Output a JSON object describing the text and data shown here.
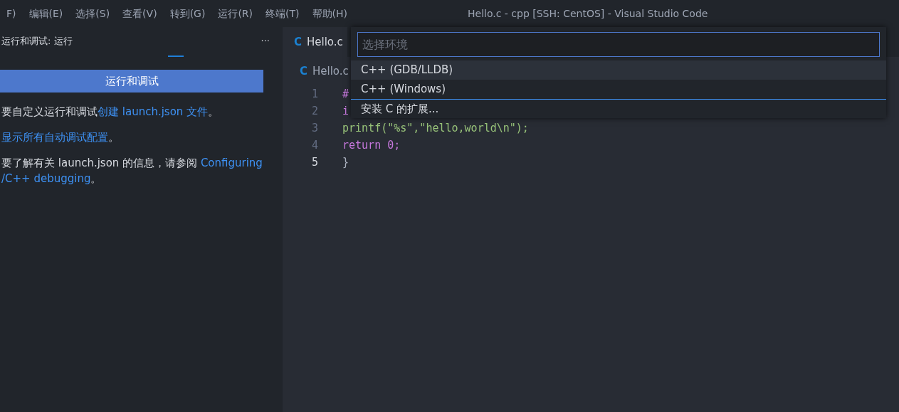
{
  "menu_bar": {
    "items": [
      "F)",
      "编辑(E)",
      "选择(S)",
      "查看(V)",
      "转到(G)",
      "运行(R)",
      "终端(T)",
      "帮助(H)"
    ]
  },
  "window": {
    "title": "Hello.c - cpp [SSH: CentOS] - Visual Studio Code"
  },
  "sidebar": {
    "title": "运行和调试: 运行",
    "more": "···",
    "run_button": "运行和调试",
    "paragraphs": [
      {
        "before": "要自定义运行和调试",
        "links": [
          "创建 launch.json 文件"
        ],
        "after": "。"
      },
      {
        "links": [
          "显示所有自动调试配置"
        ],
        "after": "。"
      },
      {
        "before": "要了解有关 launch.json 的信息，请参阅 ",
        "links": [
          "Configuring",
          "/C++ debugging"
        ],
        "after": "。"
      }
    ]
  },
  "editor": {
    "tabs": [
      {
        "icon": "C",
        "label": "Hello.c",
        "selected": true
      }
    ],
    "breadcrumb": {
      "icon": "C",
      "label": "Hello.c"
    },
    "lines": [
      {
        "number": "1",
        "text": "#",
        "current": false
      },
      {
        "number": "2",
        "text": "i",
        "current": false
      },
      {
        "number": "3",
        "text": "printf(\"%s\",\"hello,world\\n\");",
        "current": false
      },
      {
        "number": "4",
        "text": "return 0;",
        "current": false
      },
      {
        "number": "5",
        "text": "}",
        "current": true
      }
    ]
  },
  "quick_pick": {
    "placeholder": "选择环境",
    "items": [
      {
        "label": "C++ (GDB/LLDB)",
        "selected": true
      },
      {
        "label": "C++ (Windows)",
        "selected": false
      },
      {
        "label": "安装 C 的扩展...",
        "selected": false
      }
    ]
  }
}
